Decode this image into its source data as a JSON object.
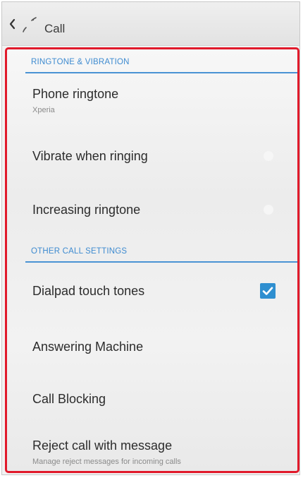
{
  "header": {
    "title": "Call"
  },
  "sections": {
    "ringtone_vibration": {
      "header": "RINGTONE & VIBRATION",
      "items": {
        "phone_ringtone": {
          "title": "Phone ringtone",
          "summary": "Xperia"
        },
        "vibrate": {
          "title": "Vibrate when ringing"
        },
        "increasing": {
          "title": "Increasing ringtone"
        }
      }
    },
    "other_call_settings": {
      "header": "OTHER CALL SETTINGS",
      "items": {
        "dialpad": {
          "title": "Dialpad touch tones",
          "checked": true
        },
        "answering": {
          "title": "Answering Machine"
        },
        "blocking": {
          "title": "Call Blocking"
        },
        "reject": {
          "title": "Reject call with message",
          "summary": "Manage reject messages for incoming calls"
        }
      }
    }
  },
  "colors": {
    "accent": "#3e8bd0",
    "highlight_border": "#e11a2b",
    "checkbox": "#2f8fd0"
  },
  "icons": {
    "up": "chevron-left-icon",
    "app": "phone-app-icon",
    "check": "check-icon"
  }
}
